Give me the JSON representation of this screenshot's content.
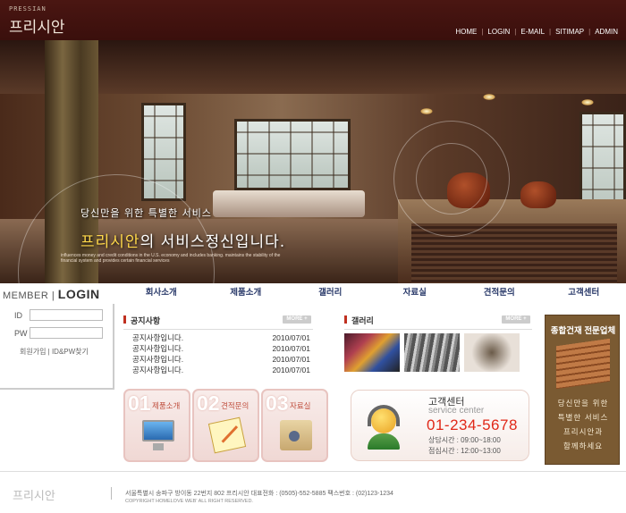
{
  "header": {
    "logo_small": "PRESSIAN",
    "logo_main": "프리시안",
    "top_nav": [
      "HOME",
      "LOGIN",
      "E-MAIL",
      "SITIMAP",
      "ADMIN"
    ]
  },
  "hero": {
    "tagline_1": "당신만을 위한 특별한 서비스",
    "tagline_2_highlight": "프리시안",
    "tagline_2_rest": "의 서비스정신입니다.",
    "tagline_3": "influences money and credit conditions in the U.S. economy and includes banking. maintains the stability of the financial system and provides certain financial services"
  },
  "login": {
    "title_prefix": "MEMBER",
    "title_main": "LOGIN",
    "id_label": "ID",
    "pw_label": "PW",
    "id_value": "",
    "pw_value": "",
    "links": "회원가입 | ID&PW찾기"
  },
  "main_nav": [
    "회사소개",
    "제품소개",
    "갤러리",
    "자료실",
    "견적문의",
    "고객센터"
  ],
  "notice": {
    "title": "공지사항",
    "more": "MORE +",
    "rows": [
      {
        "title": "공지사항입니다.",
        "date": "2010/07/01"
      },
      {
        "title": "공지사항입니다.",
        "date": "2010/07/01"
      },
      {
        "title": "공지사항입니다.",
        "date": "2010/07/01"
      },
      {
        "title": "공지사항입니다.",
        "date": "2010/07/01"
      }
    ]
  },
  "gallery": {
    "title": "갤러리",
    "more": "MORE +"
  },
  "products": [
    {
      "num": "01",
      "label": "제품소개",
      "icon": "monitor-icon"
    },
    {
      "num": "02",
      "label": "견적문의",
      "icon": "note-pencil-icon"
    },
    {
      "num": "03",
      "label": "자료실",
      "icon": "folder-icon"
    }
  ],
  "service": {
    "title": "고객센터",
    "subtitle": "service center",
    "phone": "01-234-5678",
    "hours_1": "상담시간 : 09:00~18:00",
    "hours_2": "점심시간 : 12:00~13:00"
  },
  "banner": {
    "title": "종합건재 전문업체",
    "lines": [
      "당신만을 위한",
      "특별한 서비스",
      "프리시안과",
      "함께하세요"
    ]
  },
  "footer": {
    "logo": "프리시안",
    "address": "서울특별시 송파구 방이동 22번지 802 프리시안 대표전화 : (0505)-552-5885 팩스번호 : (02)123-1234",
    "copyright": "COPYRIGHT HOMELOVE WEB' ALL RIGHT RESERVED."
  },
  "colors": {
    "header_bg": "#3a0f0c",
    "accent_red": "#e02818",
    "nav_blue": "#2a3a6a",
    "banner_brown": "#7a5a32"
  }
}
